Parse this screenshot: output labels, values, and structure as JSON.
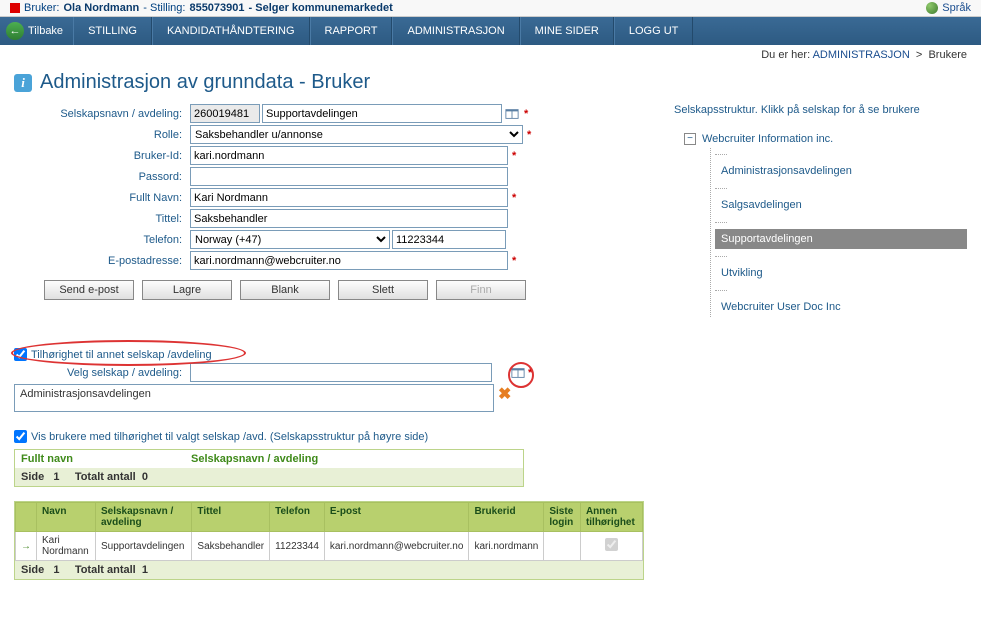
{
  "topbar": {
    "user_label": "Bruker:",
    "user_value": "Ola Nordmann",
    "pos_label": "- Stilling:",
    "pos_value": "855073901",
    "role_value": "- Selger kommunemarkedet",
    "language": "Språk"
  },
  "nav": {
    "back": "Tilbake",
    "items": [
      "STILLING",
      "KANDIDATHÅNDTERING",
      "RAPPORT",
      "ADMINISTRASJON",
      "MINE SIDER",
      "LOGG UT"
    ]
  },
  "breadcrumb": {
    "prefix": "Du er her:",
    "l1": "ADMINISTRASJON",
    "sep": ">",
    "l2": "Brukere"
  },
  "page_title": "Administrasjon av grunndata - Bruker",
  "form": {
    "company_label": "Selskapsnavn / avdeling:",
    "company_code": "260019481",
    "company_name": "Supportavdelingen",
    "role_label": "Rolle:",
    "role_value": "Saksbehandler u/annonse",
    "userid_label": "Bruker-Id:",
    "userid_value": "kari.nordmann",
    "password_label": "Passord:",
    "password_value": "",
    "fullname_label": "Fullt Navn:",
    "fullname_value": "Kari Nordmann",
    "title_label": "Tittel:",
    "title_value": "Saksbehandler",
    "phone_label": "Telefon:",
    "phone_country": "Norway (+47)",
    "phone_value": "11223344",
    "email_label": "E-postadresse:",
    "email_value": "kari.nordmann@webcruiter.no"
  },
  "buttons": {
    "send_email": "Send e-post",
    "save": "Lagre",
    "blank": "Blank",
    "delete": "Slett",
    "find": "Finn"
  },
  "affiliation": {
    "checkbox_label": "Tilhørighet til annet selskap /avdeling",
    "select_label": "Velg selskap / avdeling:",
    "list_item": "Administrasjonsavdelingen"
  },
  "show_users": {
    "label": "Vis brukere med tilhørighet til valgt selskap /avd. (Selskapsstruktur på høyre side)"
  },
  "grid1": {
    "col1": "Fullt navn",
    "col2": "Selskapsnavn / avdeling",
    "footer_page": "Side",
    "footer_pagenum": "1",
    "footer_total_label": "Totalt antall",
    "footer_total": "0"
  },
  "grid2": {
    "headers": [
      "",
      "Navn",
      "Selskapsnavn / avdeling",
      "Tittel",
      "Telefon",
      "E-post",
      "Brukerid",
      "Siste login",
      "Annen tilhørighet"
    ],
    "row": {
      "name": "Kari Nordmann",
      "dept": "Supportavdelingen",
      "title": "Saksbehandler",
      "phone": "11223344",
      "email": "kari.nordmann@webcruiter.no",
      "userid": "kari.nordmann",
      "lastlogin": ""
    },
    "footer_page": "Side",
    "footer_pagenum": "1",
    "footer_total_label": "Totalt antall",
    "footer_total": "1"
  },
  "tree": {
    "title": "Selskapsstruktur. Klikk på selskap for å se brukere",
    "root": "Webcruiter Information inc.",
    "children": [
      "Administrasjonsavdelingen",
      "Salgsavdelingen",
      "Supportavdelingen",
      "Utvikling",
      "Webcruiter User Doc Inc"
    ],
    "selected_index": 2
  },
  "required_marker": "*"
}
